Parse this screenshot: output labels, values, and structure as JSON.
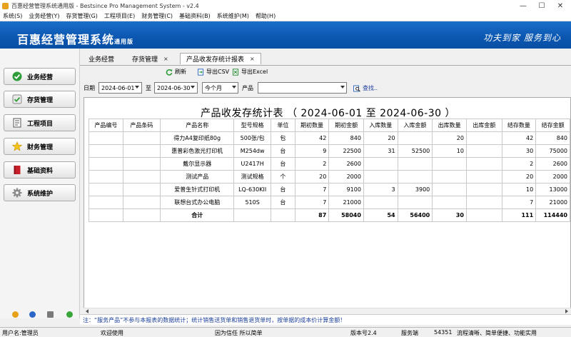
{
  "window": {
    "title": "百惠经营管理系统通用版 - Bestsince Pro Management System - v2.4",
    "controls": [
      "—",
      "☐",
      "✕"
    ]
  },
  "menu": [
    "系统(S)",
    "业务经营(Y)",
    "存货管理(G)",
    "工程项目(E)",
    "财务管理(C)",
    "基础资料(B)",
    "系统维护(M)",
    "帮助(H)"
  ],
  "banner": {
    "app_name": "百惠经营管理系统",
    "edition": "通用版",
    "slogan": "功夫到家  服务到心"
  },
  "sidebar": {
    "items": [
      {
        "label": "业务经营",
        "icon": "check-icon"
      },
      {
        "label": "存货管理",
        "icon": "check-icon"
      },
      {
        "label": "工程项目",
        "icon": "document-icon"
      },
      {
        "label": "财务管理",
        "icon": "star-icon"
      },
      {
        "label": "基础资料",
        "icon": "book-icon"
      },
      {
        "label": "系统维护",
        "icon": "gear-icon"
      }
    ]
  },
  "tabs": [
    {
      "label": "业务经营",
      "closable": false
    },
    {
      "label": "存货管理",
      "closable": true
    },
    {
      "label": "产品收发存统计报表",
      "closable": true,
      "active": true
    }
  ],
  "toolbar": {
    "refresh": "刷新",
    "export_csv": "导出CSV",
    "export_excel": "导出Excel"
  },
  "filter": {
    "date_label": "日期",
    "date_from": "2024-06-01",
    "to_label": "至",
    "date_to": "2024-06-30",
    "period": "今个月",
    "product_label": "产品",
    "product_value": "",
    "search": "查找.."
  },
  "report": {
    "title": "产品收发存统计表  （ 2024-06-01  至  2024-06-30 ）",
    "columns": [
      "产品编号",
      "产品条码",
      "产品名称",
      "型号规格",
      "单位",
      "期初数量",
      "期初金额",
      "入库数量",
      "入库金额",
      "出库数量",
      "出库金额",
      "结存数量",
      "结存金额"
    ],
    "rows": [
      [
        "",
        "",
        "得力A4复印纸80g",
        "500张/包",
        "包",
        "42",
        "840",
        "20",
        "",
        "20",
        "",
        "42",
        "840"
      ],
      [
        "",
        "",
        "惠普彩色激光打印机",
        "M254dw",
        "台",
        "9",
        "22500",
        "31",
        "52500",
        "10",
        "",
        "30",
        "75000"
      ],
      [
        "",
        "",
        "戴尔显示器",
        "U2417H",
        "台",
        "2",
        "2600",
        "",
        "",
        "",
        "",
        "2",
        "2600"
      ],
      [
        "",
        "",
        "测试产品",
        "测试规格",
        "个",
        "20",
        "2000",
        "",
        "",
        "",
        "",
        "20",
        "2000"
      ],
      [
        "",
        "",
        "爱普生针式打印机",
        "LQ-630KII",
        "台",
        "7",
        "9100",
        "3",
        "3900",
        "",
        "",
        "10",
        "13000"
      ],
      [
        "",
        "",
        "联想台式办公电脑",
        "510S",
        "台",
        "7",
        "21000",
        "",
        "",
        "",
        "",
        "7",
        "21000"
      ]
    ],
    "total_row": [
      "",
      "",
      "合计",
      "",
      "",
      "87",
      "58040",
      "54",
      "56400",
      "30",
      "",
      "111",
      "114440"
    ]
  },
  "note": "注：“服务产品”不参与本报表的数据统计；统计销售送货单和销售退货单时，按单据的成本价计算金额！",
  "statusbar": {
    "user": "用户名:管理员",
    "welcome": "欢迎使用",
    "motto": "因为信任 所以简单",
    "version": "版本号2.4",
    "service_label": "服务端",
    "port": "54351",
    "features": "流程清晰、简单便捷、功能实用"
  },
  "colors": {
    "banner_top": "#1a6fc9",
    "banner_bottom": "#0a4fa4",
    "note_text": "#1a3d9a",
    "link_blue": "#1a3d9a"
  }
}
